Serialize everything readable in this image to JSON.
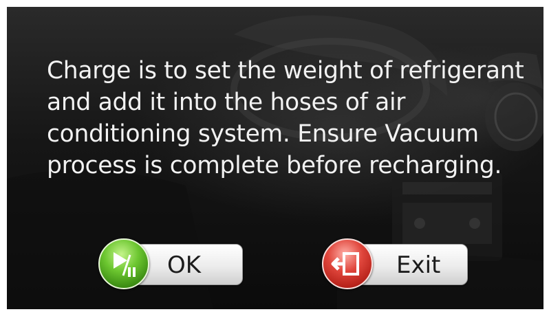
{
  "dialog": {
    "message": "Charge is to set the weight of refrigerant and add it into the hoses of air conditioning system. Ensure Vacuum process is complete before recharging."
  },
  "buttons": {
    "ok": {
      "label": "OK",
      "icon": "play-pause-icon",
      "color": "#5bb52a"
    },
    "exit": {
      "label": "Exit",
      "icon": "exit-door-icon",
      "color": "#d33a30"
    }
  }
}
